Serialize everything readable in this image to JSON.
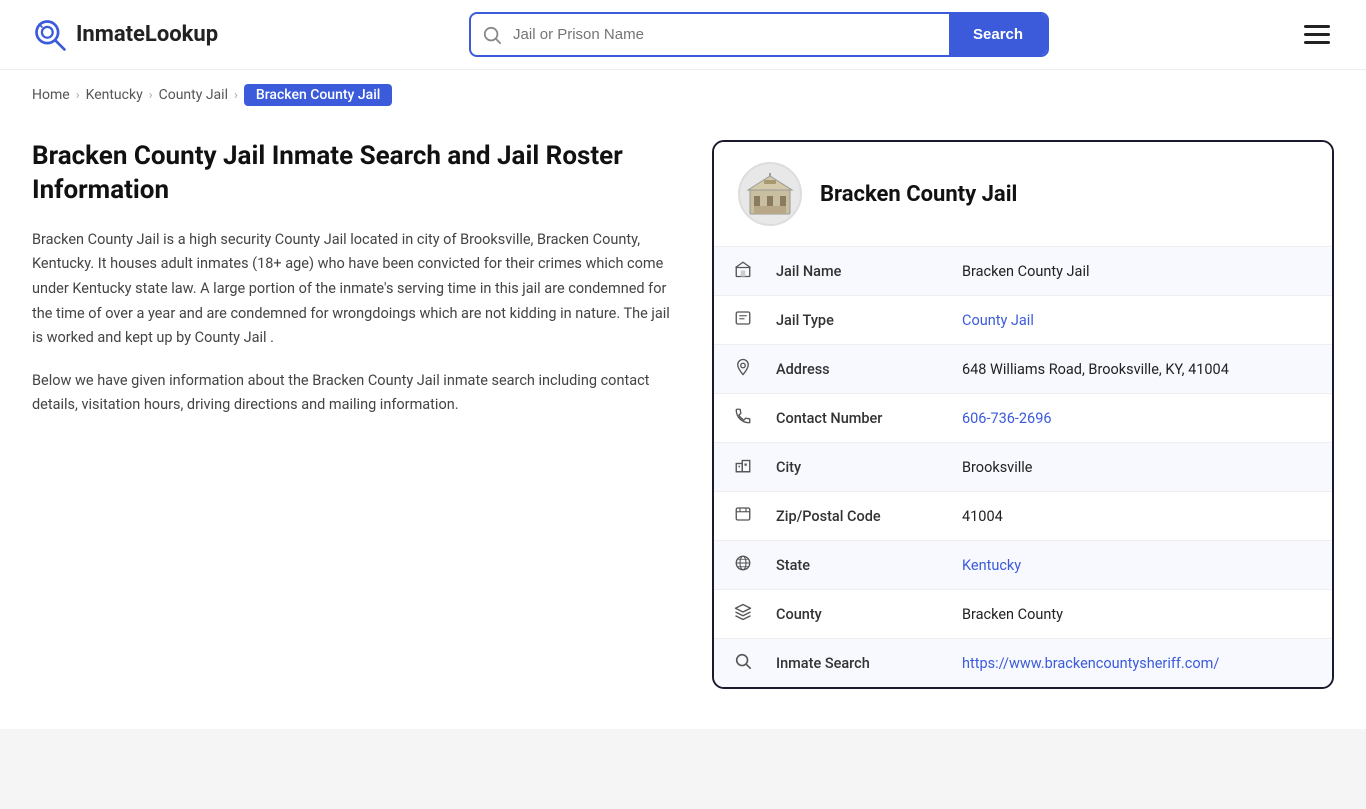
{
  "header": {
    "logo_text_part1": "Inmate",
    "logo_text_part2": "Lookup",
    "search_placeholder": "Jail or Prison Name",
    "search_button_label": "Search"
  },
  "breadcrumb": {
    "items": [
      {
        "label": "Home",
        "href": "#"
      },
      {
        "label": "Kentucky",
        "href": "#"
      },
      {
        "label": "County Jail",
        "href": "#"
      },
      {
        "label": "Bracken County Jail",
        "active": true
      }
    ]
  },
  "left": {
    "title": "Bracken County Jail Inmate Search and Jail Roster Information",
    "desc1": "Bracken County Jail is a high security County Jail located in city of Brooksville, Bracken County, Kentucky. It houses adult inmates (18+ age) who have been convicted for their crimes which come under Kentucky state law. A large portion of the inmate's serving time in this jail are condemned for the time of over a year and are condemned for wrongdoings which are not kidding in nature. The jail is worked and kept up by County Jail .",
    "desc2": "Below we have given information about the Bracken County Jail inmate search including contact details, visitation hours, driving directions and mailing information."
  },
  "card": {
    "title": "Bracken County Jail",
    "rows": [
      {
        "icon": "jail",
        "label": "Jail Name",
        "value": "Bracken County Jail",
        "link": null
      },
      {
        "icon": "type",
        "label": "Jail Type",
        "value": "County Jail",
        "link": "#"
      },
      {
        "icon": "location",
        "label": "Address",
        "value": "648 Williams Road, Brooksville, KY, 41004",
        "link": null
      },
      {
        "icon": "phone",
        "label": "Contact Number",
        "value": "606-736-2696",
        "link": "tel:606-736-2696"
      },
      {
        "icon": "city",
        "label": "City",
        "value": "Brooksville",
        "link": null
      },
      {
        "icon": "zip",
        "label": "Zip/Postal Code",
        "value": "41004",
        "link": null
      },
      {
        "icon": "globe",
        "label": "State",
        "value": "Kentucky",
        "link": "#"
      },
      {
        "icon": "county",
        "label": "County",
        "value": "Bracken County",
        "link": null
      },
      {
        "icon": "search",
        "label": "Inmate Search",
        "value": "https://www.brackencountysheriff.com/",
        "link": "https://www.brackencountysheriff.com/"
      }
    ]
  }
}
